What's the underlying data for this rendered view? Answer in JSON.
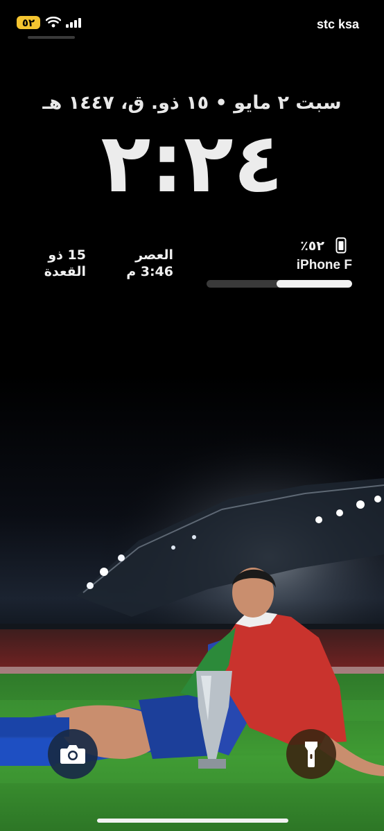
{
  "status_bar": {
    "battery_badge": "٥٢",
    "carrier": "stc ksa",
    "icons": [
      "wifi-icon",
      "cellular-signal-icon"
    ],
    "battery_color": "#f4c430"
  },
  "lock_screen": {
    "date": "سبت ٢ مايو • ١٥ ذو. ق، ١٤٤٧ هـ",
    "time": "٢:٢٤"
  },
  "widgets": {
    "hijri": {
      "line1": "15 ذو",
      "line2": "القعدة"
    },
    "prayer": {
      "name": "العصر",
      "time": "3:46 م"
    },
    "battery": {
      "percent": "٪٥٢",
      "device": "iPhone F",
      "level": 0.52,
      "icon": "iphone-icon"
    }
  },
  "quick_actions": {
    "camera": {
      "icon": "camera-icon"
    },
    "flashlight": {
      "icon": "flashlight-icon"
    }
  }
}
